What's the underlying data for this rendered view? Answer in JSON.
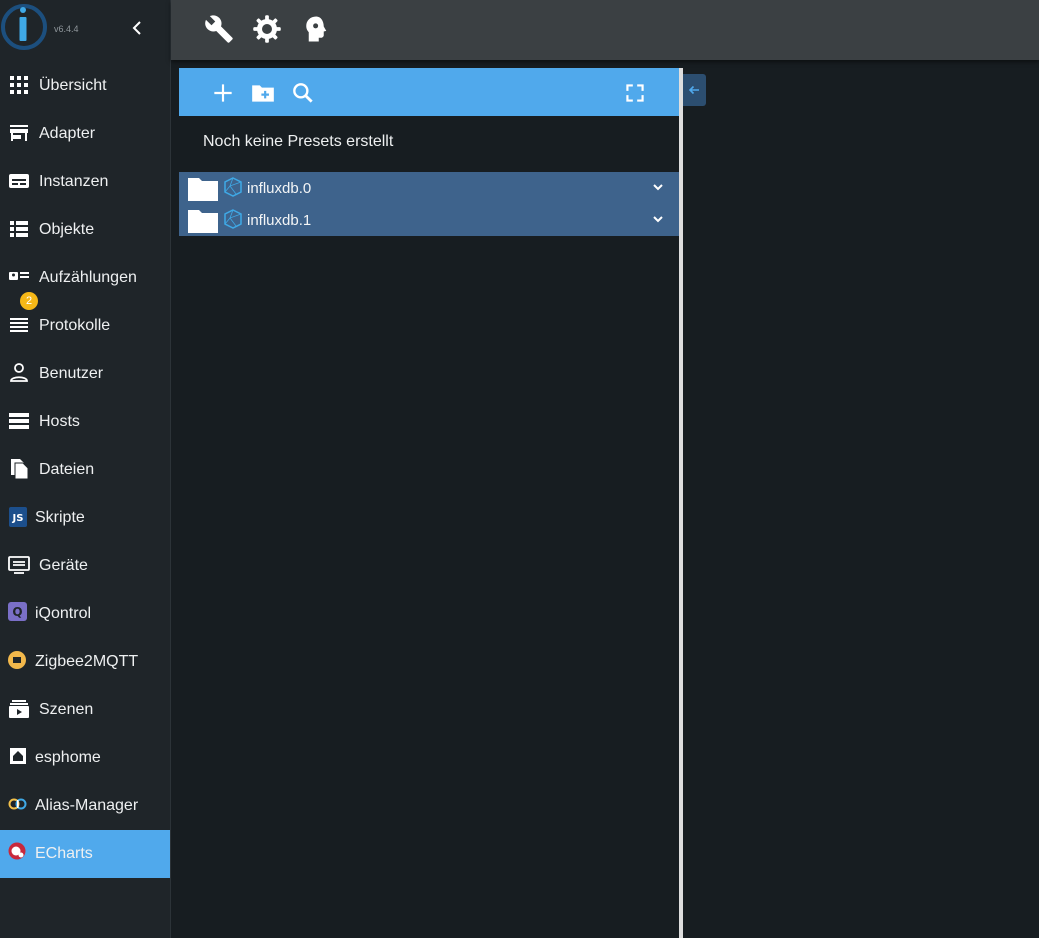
{
  "app": {
    "version": "v6.4.4"
  },
  "sidebar": {
    "items": [
      {
        "label": "Übersicht",
        "icon": "apps-grid-icon"
      },
      {
        "label": "Adapter",
        "icon": "store-icon"
      },
      {
        "label": "Instanzen",
        "icon": "instances-icon"
      },
      {
        "label": "Objekte",
        "icon": "list-icon"
      },
      {
        "label": "Aufzählungen",
        "icon": "enum-icon"
      },
      {
        "label": "Protokolle",
        "icon": "log-icon",
        "badge": "2"
      },
      {
        "label": "Benutzer",
        "icon": "user-icon"
      },
      {
        "label": "Hosts",
        "icon": "storage-icon"
      },
      {
        "label": "Dateien",
        "icon": "files-icon"
      },
      {
        "label": "Skripte",
        "icon": "javascript-icon"
      },
      {
        "label": "Geräte",
        "icon": "devices-icon"
      },
      {
        "label": "iQontrol",
        "icon": "iqontrol-icon"
      },
      {
        "label": "Zigbee2MQTT",
        "icon": "zigbee-icon"
      },
      {
        "label": "Szenen",
        "icon": "scenes-icon"
      },
      {
        "label": "esphome",
        "icon": "esphome-icon"
      },
      {
        "label": "Alias-Manager",
        "icon": "alias-icon"
      },
      {
        "label": "ECharts",
        "icon": "echarts-icon",
        "active": true
      }
    ]
  },
  "toolbar": {
    "buttons": [
      "wrench-icon",
      "gear-icon",
      "expert-mode-icon"
    ]
  },
  "panel": {
    "toolbar": [
      "add-icon",
      "add-folder-icon",
      "search-icon",
      "fullscreen-icon"
    ],
    "empty_message": "Noch keine Presets erstellt",
    "tree": [
      {
        "label": "influxdb.0"
      },
      {
        "label": "influxdb.1"
      }
    ]
  },
  "colors": {
    "accent": "#50a9ec",
    "background": "#171d21",
    "sidebar": "#1f2529",
    "topbar": "#3b4043",
    "tree_row": "#3e638c",
    "badge": "#f6b817"
  }
}
